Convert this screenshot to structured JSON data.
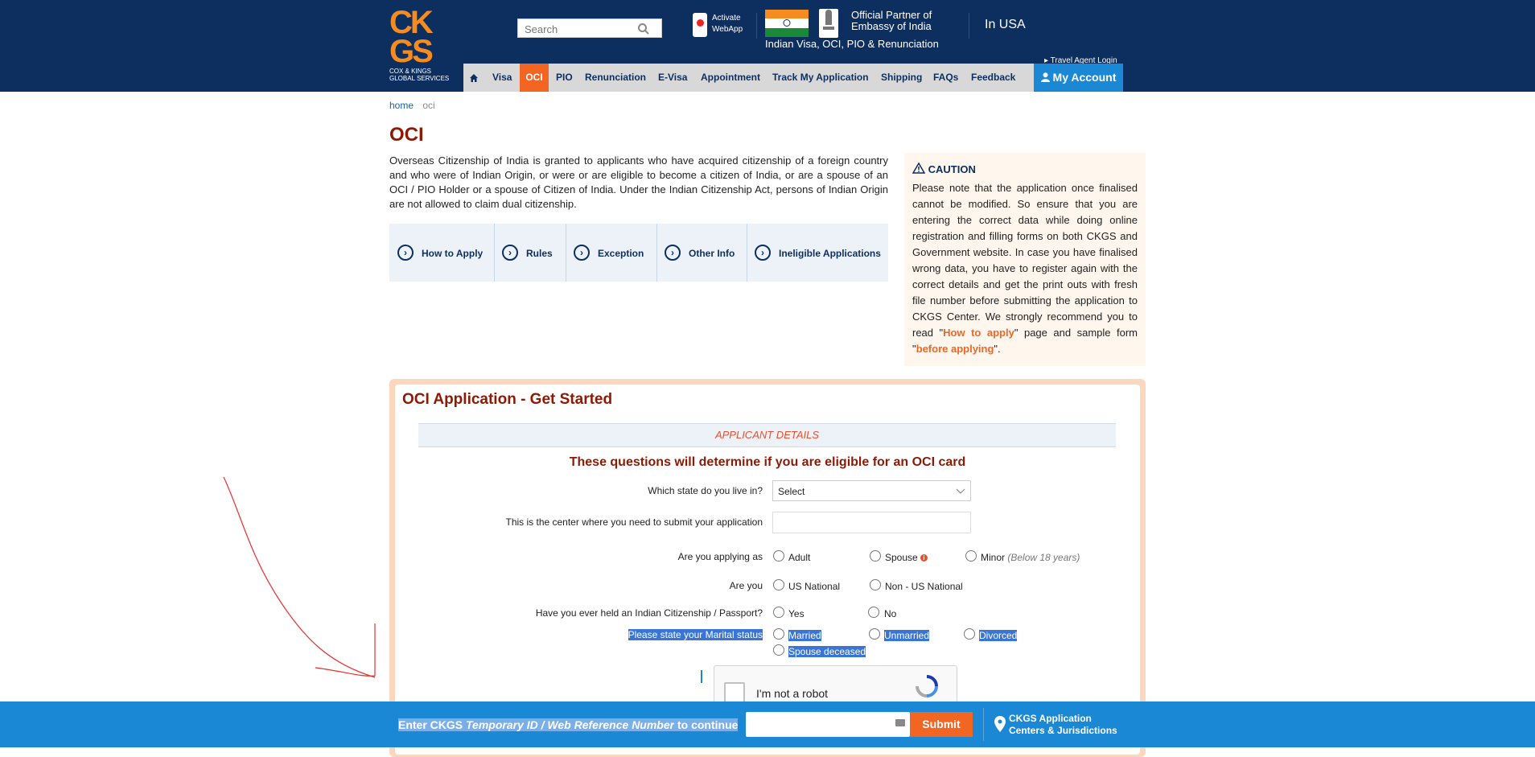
{
  "header": {
    "logo_text": "CK GS",
    "logo_sub": "COX & KINGS GLOBAL SERVICES",
    "search_placeholder": "Search",
    "activate_line1": "Activate",
    "activate_line2": "WebApp",
    "partner_line1": "Official Partner of",
    "partner_line2": "Embassy of India",
    "tagline": "Indian Visa, OCI, PIO & Renunciation",
    "region": "In USA",
    "travel_agent_login": "Travel Agent Login"
  },
  "nav": {
    "items": [
      "Visa",
      "OCI",
      "PIO",
      "Renunciation",
      "E-Visa",
      "Appointment",
      "Track My Application",
      "Shipping",
      "FAQs",
      "Feedback"
    ],
    "active": "OCI",
    "my_account": "My Account"
  },
  "breadcrumb": {
    "home": "home",
    "current": "oci"
  },
  "page": {
    "title": "OCI",
    "intro": "Overseas Citizenship of India is granted to applicants who have acquired citizenship of a foreign country and who were of Indian Origin, or were or are eligible to become a citizen of India, or are a spouse of an OCI / PIO Holder or a spouse of Citizen of India. Under the Indian Citizenship Act, persons of Indian Origin are not allowed to claim dual citizenship."
  },
  "tabs": [
    "How to Apply",
    "Rules",
    "Exception",
    "Other Info",
    "Ineligible Applications"
  ],
  "caution": {
    "title": "CAUTION",
    "body_start": "Please note that the application once finalised cannot be modified. So ensure that you are entering the correct data while doing online registration and filling forms on both CKGS and Government website. In case you have finalised wrong data, you have to register again with the correct details and get the print outs with fresh file number before submitting the application to CKGS Center. We strongly recommend you to read \"",
    "link1": "How to apply",
    "body_mid": "\" page and sample form \"",
    "link2": "before applying",
    "body_end": "\"."
  },
  "form": {
    "title": "OCI Application - Get Started",
    "section": "APPLICANT DETAILS",
    "heading": "These questions will determine if you are eligible for an OCI card",
    "q_state": "Which state do you live in?",
    "state_value": "Select",
    "q_center": "This is the center where you need to submit your application",
    "q_applying_as": "Are you applying as",
    "opt_adult": "Adult",
    "opt_spouse": "Spouse",
    "opt_minor": "Minor",
    "minor_note": "(Below 18 years)",
    "q_are_you": "Are you",
    "opt_us": "US National",
    "opt_nonus": "Non - US National",
    "q_passport": "Have you ever held an Indian Citizenship / Passport?",
    "opt_yes": "Yes",
    "opt_no": "No",
    "q_marital": "Please state your Marital status",
    "opt_married": "Married",
    "opt_unmarried": "Unmarried",
    "opt_divorced": "Divorced",
    "opt_deceased": "Spouse deceased",
    "captcha_label": "I'm not a robot"
  },
  "footer": {
    "prompt_start": "Enter CKGS ",
    "prompt_em": "Temporary ID / Web Reference Number",
    "prompt_end": " to continue",
    "submit": "Submit",
    "location_line1": "CKGS Application",
    "location_line2": "Centers & Jurisdictions"
  },
  "colors": {
    "header_bg": "#0d2f5f",
    "accent": "#f26522",
    "brand_orange": "#f68b1f",
    "title_red": "#8b1a06",
    "blue": "#1b88d6"
  }
}
